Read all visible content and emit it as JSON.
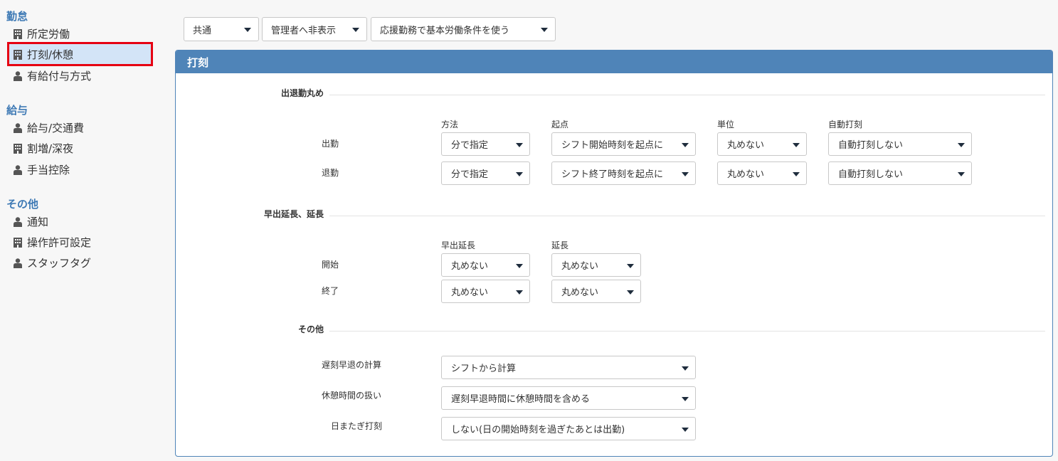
{
  "sidebar": {
    "sections": [
      {
        "title": "勤怠",
        "items": [
          {
            "label": "所定労働",
            "icon": "building-icon"
          },
          {
            "label": "打刻/休憩",
            "icon": "building-icon",
            "active": true
          },
          {
            "label": "有給付与方式",
            "icon": "person-icon"
          }
        ]
      },
      {
        "title": "給与",
        "items": [
          {
            "label": "給与/交通費",
            "icon": "person-icon"
          },
          {
            "label": "割増/深夜",
            "icon": "building-icon"
          },
          {
            "label": "手当控除",
            "icon": "person-icon"
          }
        ]
      },
      {
        "title": "その他",
        "items": [
          {
            "label": "通知",
            "icon": "person-icon"
          },
          {
            "label": "操作許可設定",
            "icon": "building-icon"
          },
          {
            "label": "スタッフタグ",
            "icon": "person-icon"
          }
        ]
      }
    ]
  },
  "filters": {
    "scope": "共通",
    "visibility": "管理者へ非表示",
    "condition": "応援勤務で基本労働条件を使う"
  },
  "panel": {
    "title": "打刻",
    "rounding": {
      "title": "出退勤丸め",
      "columns": [
        "方法",
        "起点",
        "単位",
        "自動打刻"
      ],
      "rows": [
        {
          "label": "出勤",
          "method": "分で指定",
          "origin": "シフト開始時刻を起点に",
          "unit": "丸めない",
          "auto": "自動打刻しない"
        },
        {
          "label": "退勤",
          "method": "分で指定",
          "origin": "シフト終了時刻を起点に",
          "unit": "丸めない",
          "auto": "自動打刻しない"
        }
      ]
    },
    "extension": {
      "title": "早出延長、延長",
      "columns": [
        "早出延長",
        "延長"
      ],
      "rows": [
        {
          "label": "開始",
          "early": "丸めない",
          "late": "丸めない"
        },
        {
          "label": "終了",
          "early": "丸めない",
          "late": "丸めない"
        }
      ]
    },
    "other": {
      "title": "その他",
      "rows": [
        {
          "label": "遅刻早退の計算",
          "value": "シフトから計算"
        },
        {
          "label": "休憩時間の扱い",
          "value": "遅刻早退時間に休憩時間を含める"
        },
        {
          "label": "日またぎ打刻",
          "value": "しない(日の開始時刻を過ぎたあとは出勤)"
        }
      ]
    }
  },
  "colors": {
    "accent": "#4f84b8",
    "section_title": "#3f7ab5",
    "highlight_border": "#e60012",
    "active_bg": "#d3e4f7"
  }
}
